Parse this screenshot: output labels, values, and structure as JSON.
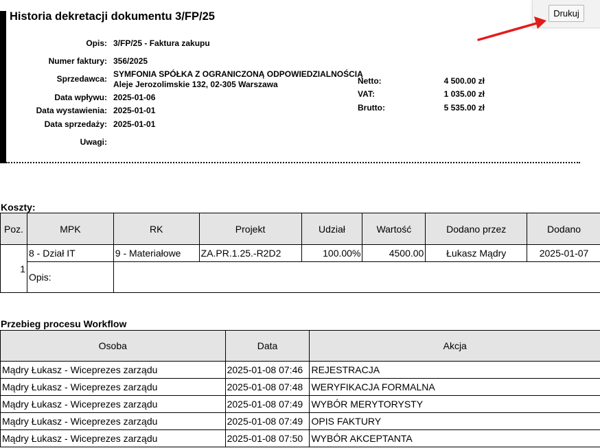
{
  "title": "Historia dekretacji dokumentu 3/FP/25",
  "print_button": "Drukuj",
  "fields": {
    "opis": {
      "label": "Opis:",
      "value": "3/FP/25 - Faktura zakupu"
    },
    "numer": {
      "label": "Numer faktury:",
      "value": "356/2025"
    },
    "sprzedawca": {
      "label": "Sprzedawca:",
      "value_line1": "SYMFONIA SPÓŁKA Z OGRANICZONĄ ODPOWIEDZIALNOŚCIĄ",
      "value_line2": "Aleje Jerozolimskie 132, 02-305 Warszawa"
    },
    "wplyw": {
      "label": "Data wpływu:",
      "value": "2025-01-06"
    },
    "wystawienie": {
      "label": "Data wystawienia:",
      "value": "2025-01-01"
    },
    "sprzedaz": {
      "label": "Data sprzedaży:",
      "value": "2025-01-01"
    },
    "uwagi": {
      "label": "Uwagi:",
      "value": ""
    }
  },
  "totals": {
    "netto": {
      "label": "Netto:",
      "value": "4 500.00 zł"
    },
    "vat": {
      "label": "VAT:",
      "value": "1 035.00 zł"
    },
    "brutto": {
      "label": "Brutto:",
      "value": "5 535.00 zł"
    }
  },
  "costs": {
    "title": "Koszty:",
    "headers": [
      "Poz.",
      "MPK",
      "RK",
      "Projekt",
      "Udział",
      "Wartość",
      "Dodano przez",
      "Dodano"
    ],
    "row": {
      "poz": "1",
      "mpk": "8 - Dział IT",
      "rk": "9 - Materiałowe",
      "projekt": "ZA.PR.1.25.-R2D2",
      "udzial": "100.00%",
      "wartosc": "4500.00",
      "dodano_przez": "Łukasz Mądry",
      "dodano": "2025-01-07"
    },
    "opis_label": "Opis:",
    "opis_value": ""
  },
  "workflow": {
    "title": "Przebieg procesu Workflow",
    "headers": [
      "Osoba",
      "Data",
      "Akcja"
    ],
    "rows": [
      {
        "osoba": "Mądry Łukasz - Wiceprezes zarządu",
        "data": "2025-01-08 07:46",
        "akcja": "REJESTRACJA"
      },
      {
        "osoba": "Mądry Łukasz - Wiceprezes zarządu",
        "data": "2025-01-08 07:48",
        "akcja": "WERYFIKACJA FORMALNA"
      },
      {
        "osoba": "Mądry Łukasz - Wiceprezes zarządu",
        "data": "2025-01-08 07:49",
        "akcja": "WYBÓR MERYTORYSTY"
      },
      {
        "osoba": "Mądry Łukasz - Wiceprezes zarządu",
        "data": "2025-01-08 07:49",
        "akcja": "OPIS FAKTURY"
      },
      {
        "osoba": "Mądry Łukasz - Wiceprezes zarządu",
        "data": "2025-01-08 07:50",
        "akcja": "WYBÓR AKCEPTANTA"
      }
    ]
  }
}
